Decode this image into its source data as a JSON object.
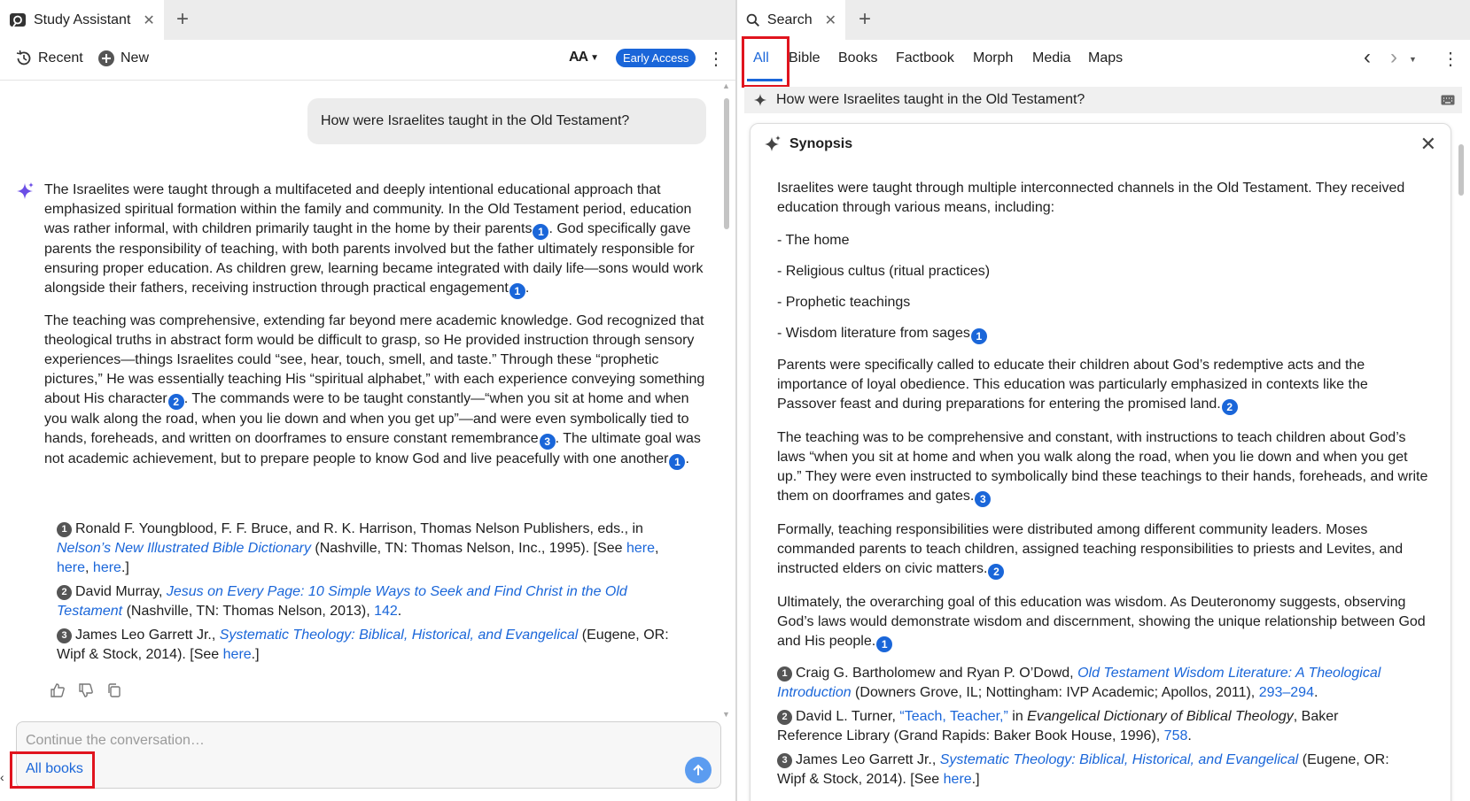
{
  "left": {
    "tab_title": "Study Assistant",
    "toolbar": {
      "recent": "Recent",
      "new": "New",
      "font_size": "AA",
      "early_access": "Early Access"
    },
    "user_question": "How were Israelites taught in the Old Testament?",
    "answer": {
      "p1": [
        "The Israelites were taught through a multifaceted and deeply intentional educational approach that emphasized spiritual formation within the family and community. In the Old Testament period, education was rather informal, with children primarily taught in the home by their parents",
        "1",
        ". God specifically gave parents the responsibility of teaching, with both parents involved but the father ultimately responsible for ensuring proper education. As children grew, learning became integrated with daily life—sons would work alongside their fathers, receiving instruction through practical engagement",
        "1",
        "."
      ],
      "p2": [
        "The teaching was comprehensive, extending far beyond mere academic knowledge. God recognized that theological truths in abstract form would be difficult to grasp, so He provided instruction through sensory experiences—things Israelites could “see, hear, touch, smell, and taste.” Through these “prophetic pictures,” He was essentially teaching His “spiritual alphabet,” with each experience conveying something about His character",
        "2",
        ". The commands were to be taught constantly—“when you sit at home and when you walk along the road, when you lie down and when you get up”—and were even symbolically tied to hands, foreheads, and written on doorframes to ensure constant remembrance",
        "3",
        ". The ultimate goal was not academic achievement, but to prepare people to know God and live peacefully with one another",
        "1",
        "."
      ]
    },
    "refs": [
      {
        "n": "1",
        "pre": "Ronald F. Youngblood, F. F. Bruce, and R. K. Harrison, Thomas Nelson Publishers, eds., in ",
        "title": "Nelson’s New Illustrated Bible Dictionary",
        "post": " (Nashville, TN: Thomas Nelson, Inc., 1995). [See ",
        "links": [
          "here",
          "here",
          "here"
        ],
        "end": ".]"
      },
      {
        "n": "2",
        "pre": "David Murray, ",
        "title": "Jesus on Every Page: 10 Simple Ways to Seek and Find Christ in the Old Testament",
        "post": " (Nashville, TN: Thomas Nelson, 2013), ",
        "links": [
          "142"
        ],
        "end": "."
      },
      {
        "n": "3",
        "pre": "James Leo Garrett Jr., ",
        "title": "Systematic Theology: Biblical, Historical, and Evangelical",
        "post": " (Eugene, OR: Wipf & Stock, 2014). [See ",
        "links": [
          "here"
        ],
        "end": ".]"
      }
    ],
    "input_placeholder": "Continue the conversation…",
    "scope_button": "All books"
  },
  "right": {
    "tab_title": "Search",
    "subtabs": [
      "All",
      "Bible",
      "Books",
      "Factbook",
      "Morph",
      "Media",
      "Maps"
    ],
    "query": "How were Israelites taught in the Old Testament?",
    "synopsis_title": "Synopsis",
    "intro": "Israelites were taught through multiple interconnected channels in the Old Testament. They received education through various means, including:",
    "bullets": [
      "- The home",
      "- Religious cultus (ritual practices)",
      "- Prophetic teachings",
      "- Wisdom literature from sages"
    ],
    "bullet_cite": "1",
    "para1": "Parents were specifically called to educate their children about God’s redemptive acts and the importance of loyal obedience. This education was particularly emphasized in contexts like the Passover feast and during preparations for entering the promised land.",
    "para1_cite": "2",
    "para2": "The teaching was to be comprehensive and constant, with instructions to teach children about God’s laws “when you sit at home and when you walk along the road, when you lie down and when you get up.” They were even instructed to symbolically bind these teachings to their hands, foreheads, and write them on doorframes and gates.",
    "para2_cite": "3",
    "para3": "Formally, teaching responsibilities were distributed among different community leaders. Moses commanded parents to teach children, assigned teaching responsibilities to priests and Levites, and instructed elders on civic matters.",
    "para3_cite": "2",
    "para4": "Ultimately, the overarching goal of this education was wisdom. As Deuteronomy suggests, observing God’s laws would demonstrate wisdom and discernment, showing the unique relationship between God and His people.",
    "para4_cite": "1",
    "refs": [
      {
        "n": "1",
        "pre": "Craig G. Bartholomew and Ryan P. O’Dowd, ",
        "title": "Old Testament Wisdom Literature: A Theological Introduction",
        "post": " (Downers Grove, IL; Nottingham: IVP Academic; Apollos, 2011), ",
        "links": [
          "293–294"
        ],
        "end": "."
      },
      {
        "n": "2",
        "pre": "David L. Turner, ",
        "title": "“Teach, Teacher,”",
        "mid": " in ",
        "title2": "Evangelical Dictionary of Biblical Theology",
        "post": ", Baker Reference Library (Grand Rapids: Baker Book House, 1996), ",
        "links": [
          "758"
        ],
        "end": "."
      },
      {
        "n": "3",
        "pre": "James Leo Garrett Jr., ",
        "title": "Systematic Theology: Biblical, Historical, and Evangelical",
        "post": " (Eugene, OR: Wipf & Stock, 2014). [See ",
        "links": [
          "here"
        ],
        "end": ".]"
      }
    ]
  },
  "colors": {
    "accent": "#1a66d9",
    "highlight_box": "#e0141e"
  }
}
